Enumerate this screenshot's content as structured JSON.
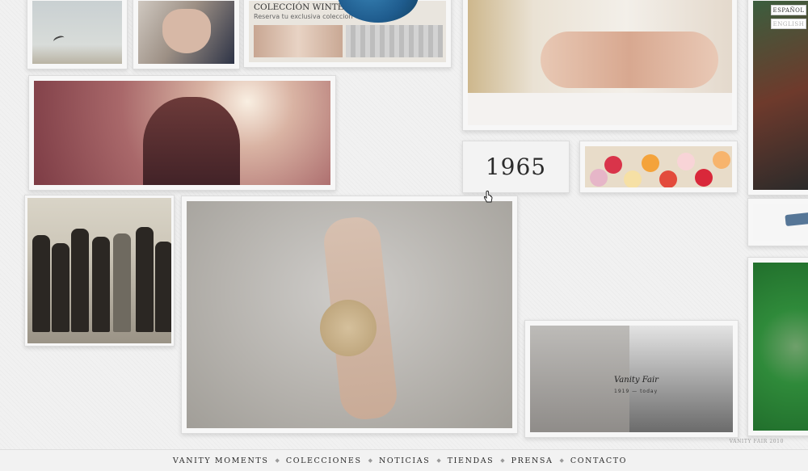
{
  "tiles": {
    "winter": {
      "title": "COLECCIÓN WINTER",
      "subtitle": "Reserva tu exclusiva coleccion"
    },
    "year": "1965",
    "vanity_fair": {
      "brand": "Vanity Fair",
      "years": "1919 — today"
    }
  },
  "languages": [
    {
      "label": "ESPAÑOL",
      "active": true
    },
    {
      "label": "ENGLISH",
      "active": false
    }
  ],
  "copyright": "VANITY FAIR 2010",
  "nav": {
    "items": [
      {
        "label": "VANITY MOMENTS"
      },
      {
        "label": "COLECCIONES"
      },
      {
        "label": "NOTICIAS"
      },
      {
        "label": "TIENDAS"
      },
      {
        "label": "PRENSA"
      },
      {
        "label": "CONTACTO"
      }
    ],
    "separator": "◆"
  },
  "colors": {
    "background": "#f1f1f1",
    "text": "#2a2a2a",
    "balloon_blue": "#1f5c8e",
    "balloon_green": "#2b7d3a"
  }
}
